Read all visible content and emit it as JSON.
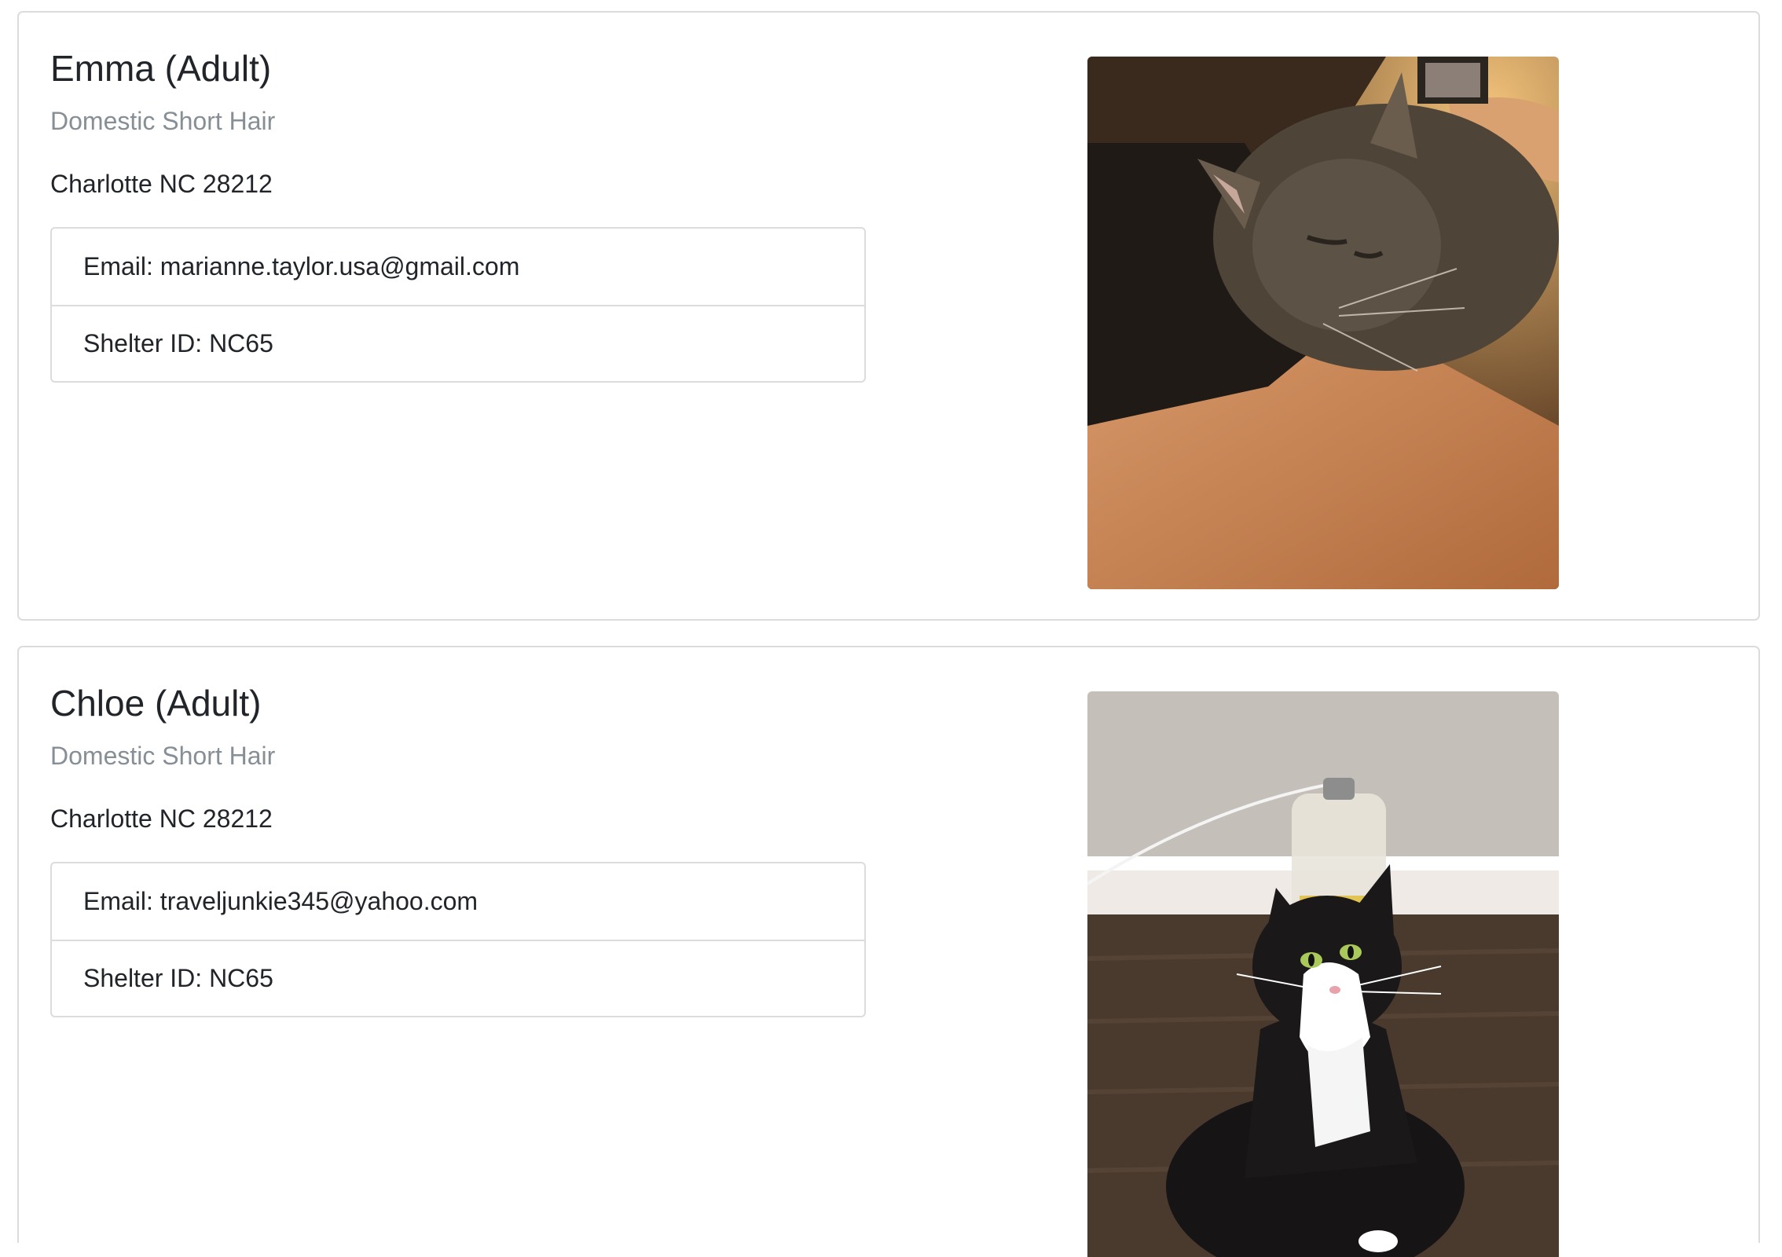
{
  "pets": [
    {
      "name": "Emma (Adult)",
      "breed": "Domestic Short Hair",
      "location": "Charlotte NC 28212",
      "email": "Email: marianne.taylor.usa@gmail.com",
      "shelter": "Shelter ID: NC65",
      "photo_subject": "gray-tabby-cat-photo"
    },
    {
      "name": "Chloe (Adult)",
      "breed": "Domestic Short Hair",
      "location": "Charlotte NC 28212",
      "email": "Email: traveljunkie345@yahoo.com",
      "shelter": "Shelter ID: NC65",
      "photo_subject": "tuxedo-cat-photo"
    }
  ],
  "colors": {
    "border": "#dcdcdc",
    "muted_text": "#868e96",
    "text": "#212529"
  }
}
